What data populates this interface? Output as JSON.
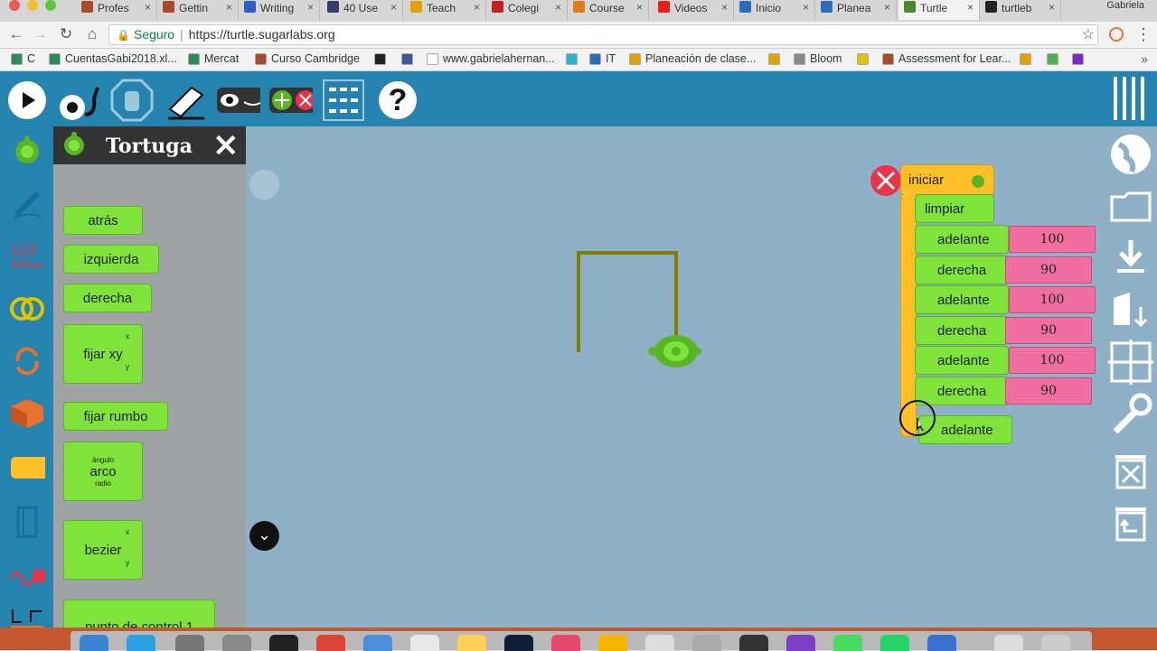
{
  "browser": {
    "tabs": [
      {
        "label": "Profes",
        "color": "#a84a2b"
      },
      {
        "label": "Gettin",
        "color": "#a84a2b"
      },
      {
        "label": "Writing",
        "color": "#2b5ec9"
      },
      {
        "label": "40 Use",
        "color": "#3b3b6b"
      },
      {
        "label": "Teach",
        "color": "#e0a300"
      },
      {
        "label": "Colegi",
        "color": "#c21f1f"
      },
      {
        "label": "Course",
        "color": "#e07b1a"
      },
      {
        "label": "Videos",
        "color": "#e62117"
      },
      {
        "label": "Inicio",
        "color": "#2a6ebb"
      },
      {
        "label": "Planea",
        "color": "#2a6ebb"
      },
      {
        "label": "Turtle",
        "color": "#4a8a2a"
      },
      {
        "label": "turtleb",
        "color": "#222222"
      }
    ],
    "profile_name": "Gabriela",
    "secure_label": "Seguro",
    "url": "https://turtle.sugarlabs.org",
    "bookmarks": [
      {
        "label": "C",
        "color": "#2e8b57"
      },
      {
        "label": "CuentasGabi2018.xl...",
        "color": "#2e8b57"
      },
      {
        "label": "Mercat",
        "color": "#2e8b57"
      },
      {
        "label": "Curso Cambridge",
        "color": "#a84a2b"
      },
      {
        "label": "",
        "color": "#222222"
      },
      {
        "label": "",
        "color": "#3b5998"
      },
      {
        "label": "www.gabrielahernan...",
        "color": "#ffffff"
      },
      {
        "label": "",
        "color": "#2bb3c9"
      },
      {
        "label": "IT",
        "color": "#2a6ebb"
      },
      {
        "label": "Planeación de clase...",
        "color": "#e0a300"
      },
      {
        "label": "",
        "color": "#e0a300"
      },
      {
        "label": "Bloom",
        "color": "#888888"
      },
      {
        "label": "",
        "color": "#e0c300"
      },
      {
        "label": "Assessment for Lear...",
        "color": "#a84a2b"
      },
      {
        "label": "",
        "color": "#e0a300"
      },
      {
        "label": "",
        "color": "#4caf50"
      },
      {
        "label": "",
        "color": "#7b2bc9"
      }
    ]
  },
  "app": {
    "drawer_title": "Tortuga",
    "palette_blocks": {
      "back": "atrás",
      "left": "izquierda",
      "right": "derecha",
      "setxy": "fijar xy",
      "setxy_x": "x",
      "setxy_y": "y",
      "setheading": "fijar rumbo",
      "arc": "arco",
      "arc_angle": "ángulo",
      "arc_radius": "radio",
      "bezier": "bezier",
      "bezier_x": "x",
      "bezier_y": "y",
      "control": "punto de control 1"
    },
    "program": {
      "start": "iniciar",
      "clean": "limpiar",
      "steps": [
        {
          "label": "adelante",
          "value": "100"
        },
        {
          "label": "derecha",
          "value": "90"
        },
        {
          "label": "adelante",
          "value": "100"
        },
        {
          "label": "derecha",
          "value": "90"
        },
        {
          "label": "adelante",
          "value": "100"
        },
        {
          "label": "derecha",
          "value": "90"
        }
      ],
      "dragging_block": "adelante"
    },
    "colors": {
      "toolbar": "#2584af",
      "canvas": "#8fb1c8",
      "block_green": "#7fe33a",
      "number_pink": "#f06fa0",
      "start_yellow": "#ffbf27",
      "pen": "#808000"
    }
  }
}
